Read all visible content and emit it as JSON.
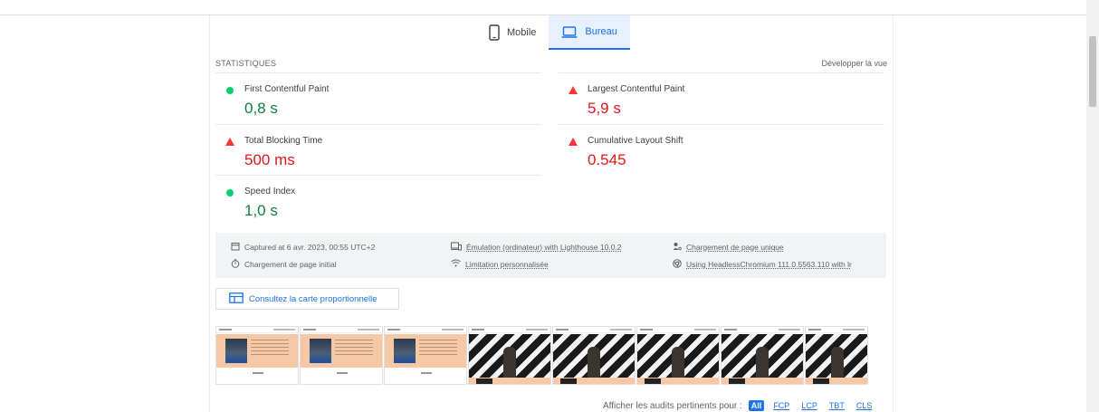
{
  "tabs": [
    {
      "label": "Mobile",
      "icon": "smartphone-icon",
      "active": false
    },
    {
      "label": "Bureau",
      "icon": "laptop-icon",
      "active": true
    }
  ],
  "stats": {
    "title": "STATISTIQUES",
    "expand_label": "Développer la vue"
  },
  "metrics": [
    {
      "name": "First Contentful Paint",
      "value": "0,8 s",
      "status": "good"
    },
    {
      "name": "Largest Contentful Paint",
      "value": "5,9 s",
      "status": "bad"
    },
    {
      "name": "Total Blocking Time",
      "value": "500 ms",
      "status": "bad"
    },
    {
      "name": "Cumulative Layout Shift",
      "value": "0.545",
      "status": "bad"
    },
    {
      "name": "Speed Index",
      "value": "1,0 s",
      "status": "good"
    }
  ],
  "runtime": {
    "captured": "Captured at 6 avr. 2023, 00:55 UTC+2",
    "initial_load": "Chargement de page initial",
    "emulation": "Émulation (ordinateur) with Lighthouse 10.0.2",
    "throttling": "Limitation personnalisée",
    "single_load": "Chargement de page unique",
    "browser": "Using HeadlessChromium 111.0.5563.110 with lr"
  },
  "treemap": {
    "label": "Consultez la carte proportionnelle"
  },
  "filmstrip": {
    "frames": [
      "hero",
      "hero",
      "hero",
      "stripes",
      "stripes",
      "stripes",
      "stripes",
      "stripes"
    ]
  },
  "audit_filter": {
    "label": "Afficher les audits pertinents pour :",
    "options": [
      "All",
      "FCP",
      "LCP",
      "TBT",
      "CLS"
    ],
    "selected": "All"
  },
  "colors": {
    "accent": "#1a73e8",
    "pass": "#0cce6b",
    "fail": "#ff3333",
    "pass_text": "#0b8043",
    "fail_text": "#e3161b"
  }
}
